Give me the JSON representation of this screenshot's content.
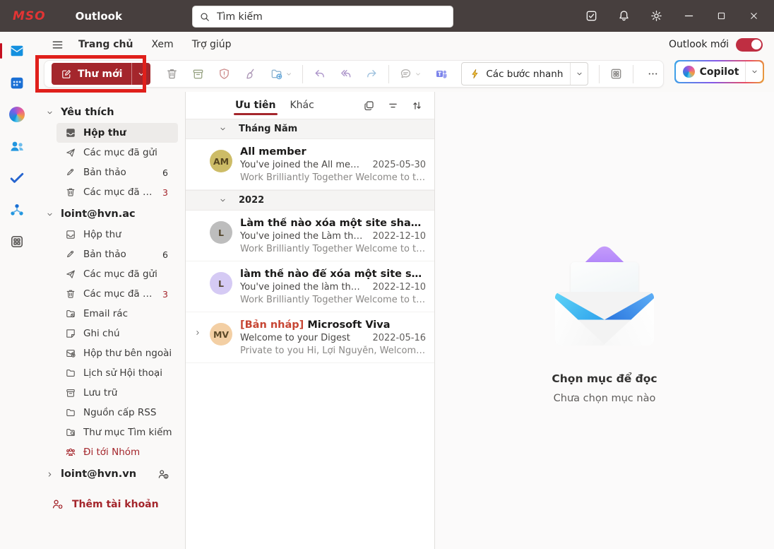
{
  "titlebar": {
    "logo": "MSO",
    "app": "Outlook",
    "search_placeholder": "Tìm kiếm"
  },
  "menubar": {
    "tabs": [
      {
        "label": "Trang chủ",
        "active": true
      },
      {
        "label": "Xem",
        "active": false
      },
      {
        "label": "Trợ giúp",
        "active": false
      }
    ],
    "new_outlook_label": "Outlook mới",
    "new_outlook_on": true
  },
  "toolbar": {
    "new_mail": "Thư mới",
    "quick_steps": "Các bước nhanh",
    "copilot": "Copilot"
  },
  "sidebar": {
    "sections": [
      {
        "header": "Yêu thích",
        "expanded": true,
        "items": [
          {
            "label": "Hộp thư",
            "icon": "inbox-icon",
            "selected": true
          },
          {
            "label": "Các mục đã gửi",
            "icon": "sent-icon"
          },
          {
            "label": "Bản thảo",
            "icon": "draft-icon",
            "count": "6"
          },
          {
            "label": "Các mục đã Xóa",
            "icon": "trash-icon",
            "count": "3",
            "count_red": true
          }
        ]
      },
      {
        "header": "loint@hvn.ac",
        "expanded": true,
        "items": [
          {
            "label": "Hộp thư",
            "icon": "inbox-icon"
          },
          {
            "label": "Bản thảo",
            "icon": "draft-icon",
            "count": "6"
          },
          {
            "label": "Các mục đã gửi",
            "icon": "sent-icon"
          },
          {
            "label": "Các mục đã Xóa",
            "icon": "trash-icon",
            "count": "3",
            "count_red": true
          },
          {
            "label": "Email rác",
            "icon": "junk-folder-icon"
          },
          {
            "label": "Ghi chú",
            "icon": "note-icon"
          },
          {
            "label": "Hộp thư bên ngoài",
            "icon": "outbox-icon"
          },
          {
            "label": "Lịch sử Hội thoại",
            "icon": "folder-icon"
          },
          {
            "label": "Lưu trữ",
            "icon": "archive-icon"
          },
          {
            "label": "Nguồn cấp RSS",
            "icon": "folder-icon"
          },
          {
            "label": "Thư mục Tìm kiếm",
            "icon": "search-folder-icon"
          },
          {
            "label": "Đi tới Nhóm",
            "icon": "groups-icon",
            "red": true
          }
        ]
      },
      {
        "header": "loint@hvn.vn",
        "expanded": false,
        "trailing_icon": "person-info-icon",
        "items": []
      }
    ],
    "add_account": "Thêm tài khoản"
  },
  "message_list": {
    "tabs": [
      {
        "label": "Ưu tiên",
        "active": true
      },
      {
        "label": "Khác",
        "active": false
      }
    ],
    "groups": [
      {
        "label": "Tháng Năm",
        "messages": [
          {
            "avatar": "AM",
            "avatar_bg": "#cdbc67",
            "sender": "All member",
            "subject": "You've joined the All memb...",
            "date": "2025-05-30",
            "preview": "Work Brilliantly Together Welcome to the ..."
          }
        ]
      },
      {
        "label": "2022",
        "messages": [
          {
            "avatar": "L",
            "avatar_bg": "#bdbdbd",
            "sender": "Làm thế nào xóa một site sharepoint",
            "subject": "You've joined the Làm thế n...",
            "date": "2022-12-10",
            "preview": "Work Brilliantly Together Welcome to the L..."
          },
          {
            "avatar": "L",
            "avatar_bg": "#d5caf4",
            "sender": "làm thế nào để xóa một site sharepo...",
            "subject": "You've joined the làm thế nà...",
            "date": "2022-12-10",
            "preview": "Work Brilliantly Together Welcome to the l..."
          },
          {
            "avatar": "MV",
            "avatar_bg": "#f3cfa4",
            "sender_tag": "[Bản nháp]",
            "sender": "Microsoft Viva",
            "subject": "Welcome to your Digest",
            "date": "2022-05-16",
            "preview": "Private to you Hi, Lợi Nguyễn, Welcome to ...",
            "expandable": true
          }
        ]
      }
    ]
  },
  "reading_pane": {
    "title": "Chọn mục để đọc",
    "subtitle": "Chưa chọn mục nào"
  },
  "colors": {
    "titlebar_bg": "#473f3e",
    "accent_red": "#a4262c",
    "annotation_red": "#e0201b",
    "toggle_on": "#bf2e42",
    "tab_underline": "#a4262c"
  }
}
